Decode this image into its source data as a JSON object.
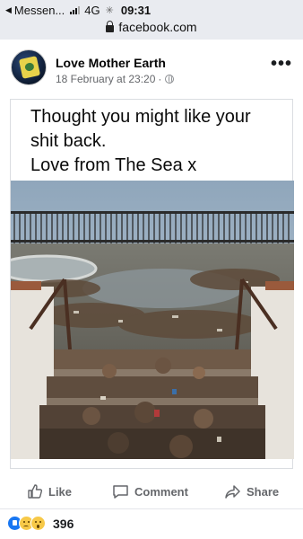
{
  "status_bar": {
    "back_app": "Messen...",
    "network": "4G",
    "time": "09:31",
    "url": "facebook.com"
  },
  "post": {
    "author": "Love Mother Earth",
    "timestamp": "18 February at 23:20",
    "separator": "·",
    "caption_lines": [
      "Thought you might like your",
      "shit back.",
      "Love from The Sea x"
    ]
  },
  "actions": {
    "like": "Like",
    "comment": "Comment",
    "share": "Share"
  },
  "reactions": {
    "icons": [
      "like-icon",
      "sad-icon",
      "wow-icon"
    ],
    "count": "396"
  },
  "colors": {
    "status_bg": "#e9ebf0",
    "meta_text": "#65676b",
    "like_blue": "#1877f2",
    "emoji_yellow": "#f7c948"
  }
}
